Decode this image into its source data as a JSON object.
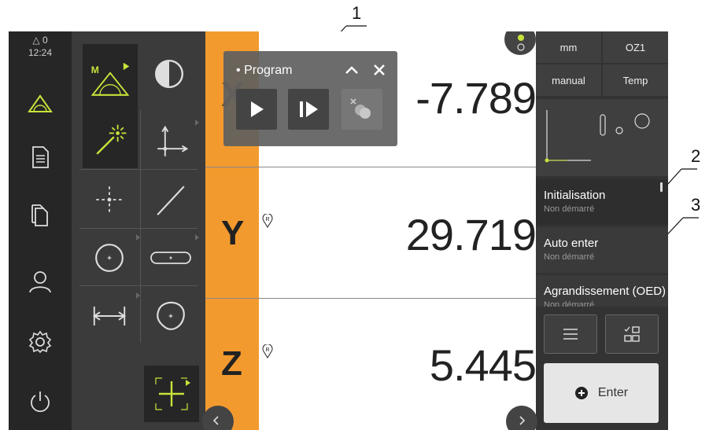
{
  "callouts": [
    "1",
    "2",
    "3"
  ],
  "status": {
    "alarm_count": "0",
    "time": "12:24"
  },
  "sidebar": {
    "items": [
      {
        "icon": "measure-icon"
      },
      {
        "icon": "document-icon"
      },
      {
        "icon": "files-icon"
      },
      {
        "icon": "user-icon"
      },
      {
        "icon": "settings-icon"
      },
      {
        "icon": "power-icon"
      }
    ]
  },
  "tools": {
    "measure_magnifier_label": "M"
  },
  "popup": {
    "title": "Program"
  },
  "axes": [
    {
      "letter": "X",
      "value": "-7.789"
    },
    {
      "letter": "Y",
      "value": "29.719"
    },
    {
      "letter": "Z",
      "value": "5.445"
    }
  ],
  "ref_marker": "R",
  "right_panel": {
    "units": "mm",
    "zero": "OZ1",
    "mode": "manual",
    "temp": "Temp",
    "steps": [
      {
        "title": "Initialisation",
        "status": "Non démarré"
      },
      {
        "title": "Auto enter",
        "status": "Non démarré"
      },
      {
        "title": "Agrandissement (OED)",
        "status": "Non démarré"
      }
    ],
    "enter_label": "Enter"
  },
  "colors": {
    "accent": "#f39a2f",
    "tool_green": "#c7e43a"
  }
}
